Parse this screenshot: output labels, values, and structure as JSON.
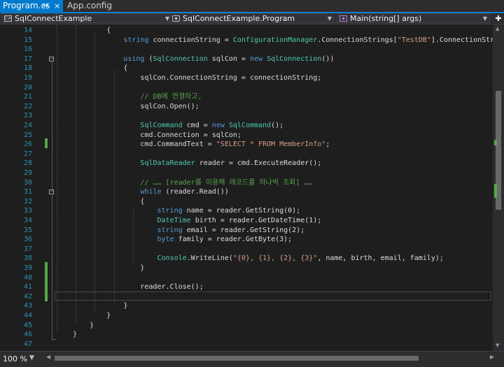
{
  "tabs": [
    {
      "label": "Program.cs",
      "active": true
    },
    {
      "label": "App.config",
      "active": false
    }
  ],
  "tab_pin_icon": "⇔",
  "tab_close_icon": "×",
  "nav": {
    "project": "SqlConnectExample",
    "class": "SqlConnectExample.Program",
    "member": "Main(string[] args)"
  },
  "editor": {
    "line_numbers": [
      "14",
      "15",
      "16",
      "17",
      "18",
      "19",
      "20",
      "21",
      "22",
      "23",
      "24",
      "25",
      "26",
      "27",
      "28",
      "29",
      "30",
      "31",
      "32",
      "33",
      "34",
      "35",
      "36",
      "37",
      "38",
      "39",
      "40",
      "41",
      "42",
      "43",
      "44",
      "45",
      "46",
      "47"
    ],
    "lines": [
      [
        {
          "t": "            {",
          "c": ""
        }
      ],
      [
        {
          "t": "                ",
          "c": ""
        },
        {
          "t": "string",
          "c": "kw"
        },
        {
          "t": " connectionString = ",
          "c": ""
        },
        {
          "t": "ConfigurationManager",
          "c": "ty"
        },
        {
          "t": ".ConnectionStrings[",
          "c": ""
        },
        {
          "t": "\"TestDB\"",
          "c": "st"
        },
        {
          "t": "].ConnectionString;",
          "c": ""
        }
      ],
      [
        {
          "t": "",
          "c": ""
        }
      ],
      [
        {
          "t": "                ",
          "c": ""
        },
        {
          "t": "using",
          "c": "kw"
        },
        {
          "t": " (",
          "c": ""
        },
        {
          "t": "SqlConnection",
          "c": "ty"
        },
        {
          "t": " sqlCon = ",
          "c": ""
        },
        {
          "t": "new",
          "c": "kw"
        },
        {
          "t": " ",
          "c": ""
        },
        {
          "t": "SqlConnection",
          "c": "ty"
        },
        {
          "t": "())",
          "c": ""
        }
      ],
      [
        {
          "t": "                {",
          "c": ""
        }
      ],
      [
        {
          "t": "                    sqlCon.ConnectionString = connectionString;",
          "c": ""
        }
      ],
      [
        {
          "t": "",
          "c": ""
        }
      ],
      [
        {
          "t": "                    ",
          "c": ""
        },
        {
          "t": "// DB에 연결하고,",
          "c": "cm"
        }
      ],
      [
        {
          "t": "                    sqlCon.Open();",
          "c": ""
        }
      ],
      [
        {
          "t": "",
          "c": ""
        }
      ],
      [
        {
          "t": "                    ",
          "c": ""
        },
        {
          "t": "SqlCommand",
          "c": "ty"
        },
        {
          "t": " cmd = ",
          "c": ""
        },
        {
          "t": "new",
          "c": "kw"
        },
        {
          "t": " ",
          "c": ""
        },
        {
          "t": "SqlCommand",
          "c": "ty"
        },
        {
          "t": "();",
          "c": ""
        }
      ],
      [
        {
          "t": "                    cmd.Connection = sqlCon;",
          "c": ""
        }
      ],
      [
        {
          "t": "                    cmd.CommandText = ",
          "c": ""
        },
        {
          "t": "\"SELECT * FROM MemberInfo\"",
          "c": "st"
        },
        {
          "t": ";",
          "c": ""
        }
      ],
      [
        {
          "t": "",
          "c": ""
        }
      ],
      [
        {
          "t": "                    ",
          "c": ""
        },
        {
          "t": "SqlDataReader",
          "c": "ty"
        },
        {
          "t": " reader = cmd.ExecuteReader();",
          "c": ""
        }
      ],
      [
        {
          "t": "",
          "c": ""
        }
      ],
      [
        {
          "t": "                    ",
          "c": ""
        },
        {
          "t": "// …… [reader를 이용해 레코드를 하나씩 조회] ……",
          "c": "cm"
        }
      ],
      [
        {
          "t": "                    ",
          "c": ""
        },
        {
          "t": "while",
          "c": "kw"
        },
        {
          "t": " (reader.Read())",
          "c": ""
        }
      ],
      [
        {
          "t": "                    {",
          "c": ""
        }
      ],
      [
        {
          "t": "                        ",
          "c": ""
        },
        {
          "t": "string",
          "c": "kw"
        },
        {
          "t": " name = reader.GetString(0);",
          "c": ""
        }
      ],
      [
        {
          "t": "                        ",
          "c": ""
        },
        {
          "t": "DateTime",
          "c": "ty"
        },
        {
          "t": " birth = reader.GetDateTime(1);",
          "c": ""
        }
      ],
      [
        {
          "t": "                        ",
          "c": ""
        },
        {
          "t": "string",
          "c": "kw"
        },
        {
          "t": " email = reader.GetString(2);",
          "c": ""
        }
      ],
      [
        {
          "t": "                        ",
          "c": ""
        },
        {
          "t": "byte",
          "c": "kw"
        },
        {
          "t": " family = reader.GetByte(3);",
          "c": ""
        }
      ],
      [
        {
          "t": "",
          "c": ""
        }
      ],
      [
        {
          "t": "                        ",
          "c": ""
        },
        {
          "t": "Console",
          "c": "ty"
        },
        {
          "t": ".WriteLine(",
          "c": ""
        },
        {
          "t": "\"{0}, {1}, {2}, {3}\"",
          "c": "st"
        },
        {
          "t": ", name, birth, email, family);",
          "c": ""
        }
      ],
      [
        {
          "t": "                    }",
          "c": ""
        }
      ],
      [
        {
          "t": "",
          "c": ""
        }
      ],
      [
        {
          "t": "                    reader.Close();",
          "c": ""
        }
      ],
      [
        {
          "t": "",
          "c": ""
        }
      ],
      [
        {
          "t": "                }",
          "c": ""
        }
      ],
      [
        {
          "t": "            }",
          "c": ""
        }
      ],
      [
        {
          "t": "        }",
          "c": ""
        }
      ],
      [
        {
          "t": "    }",
          "c": ""
        }
      ],
      [
        {
          "t": "",
          "c": ""
        }
      ]
    ]
  },
  "status": {
    "zoom": "100 %"
  },
  "colors": {
    "accent": "#007acc",
    "keyword": "#569cd6",
    "type": "#4ec9b0",
    "string": "#d69d85",
    "comment": "#57a64a",
    "linenum": "#2b91af"
  },
  "icons": [
    "cs-file-icon",
    "class-icon",
    "method-icon",
    "chevron-down-icon",
    "split-icon",
    "fold-icon"
  ]
}
